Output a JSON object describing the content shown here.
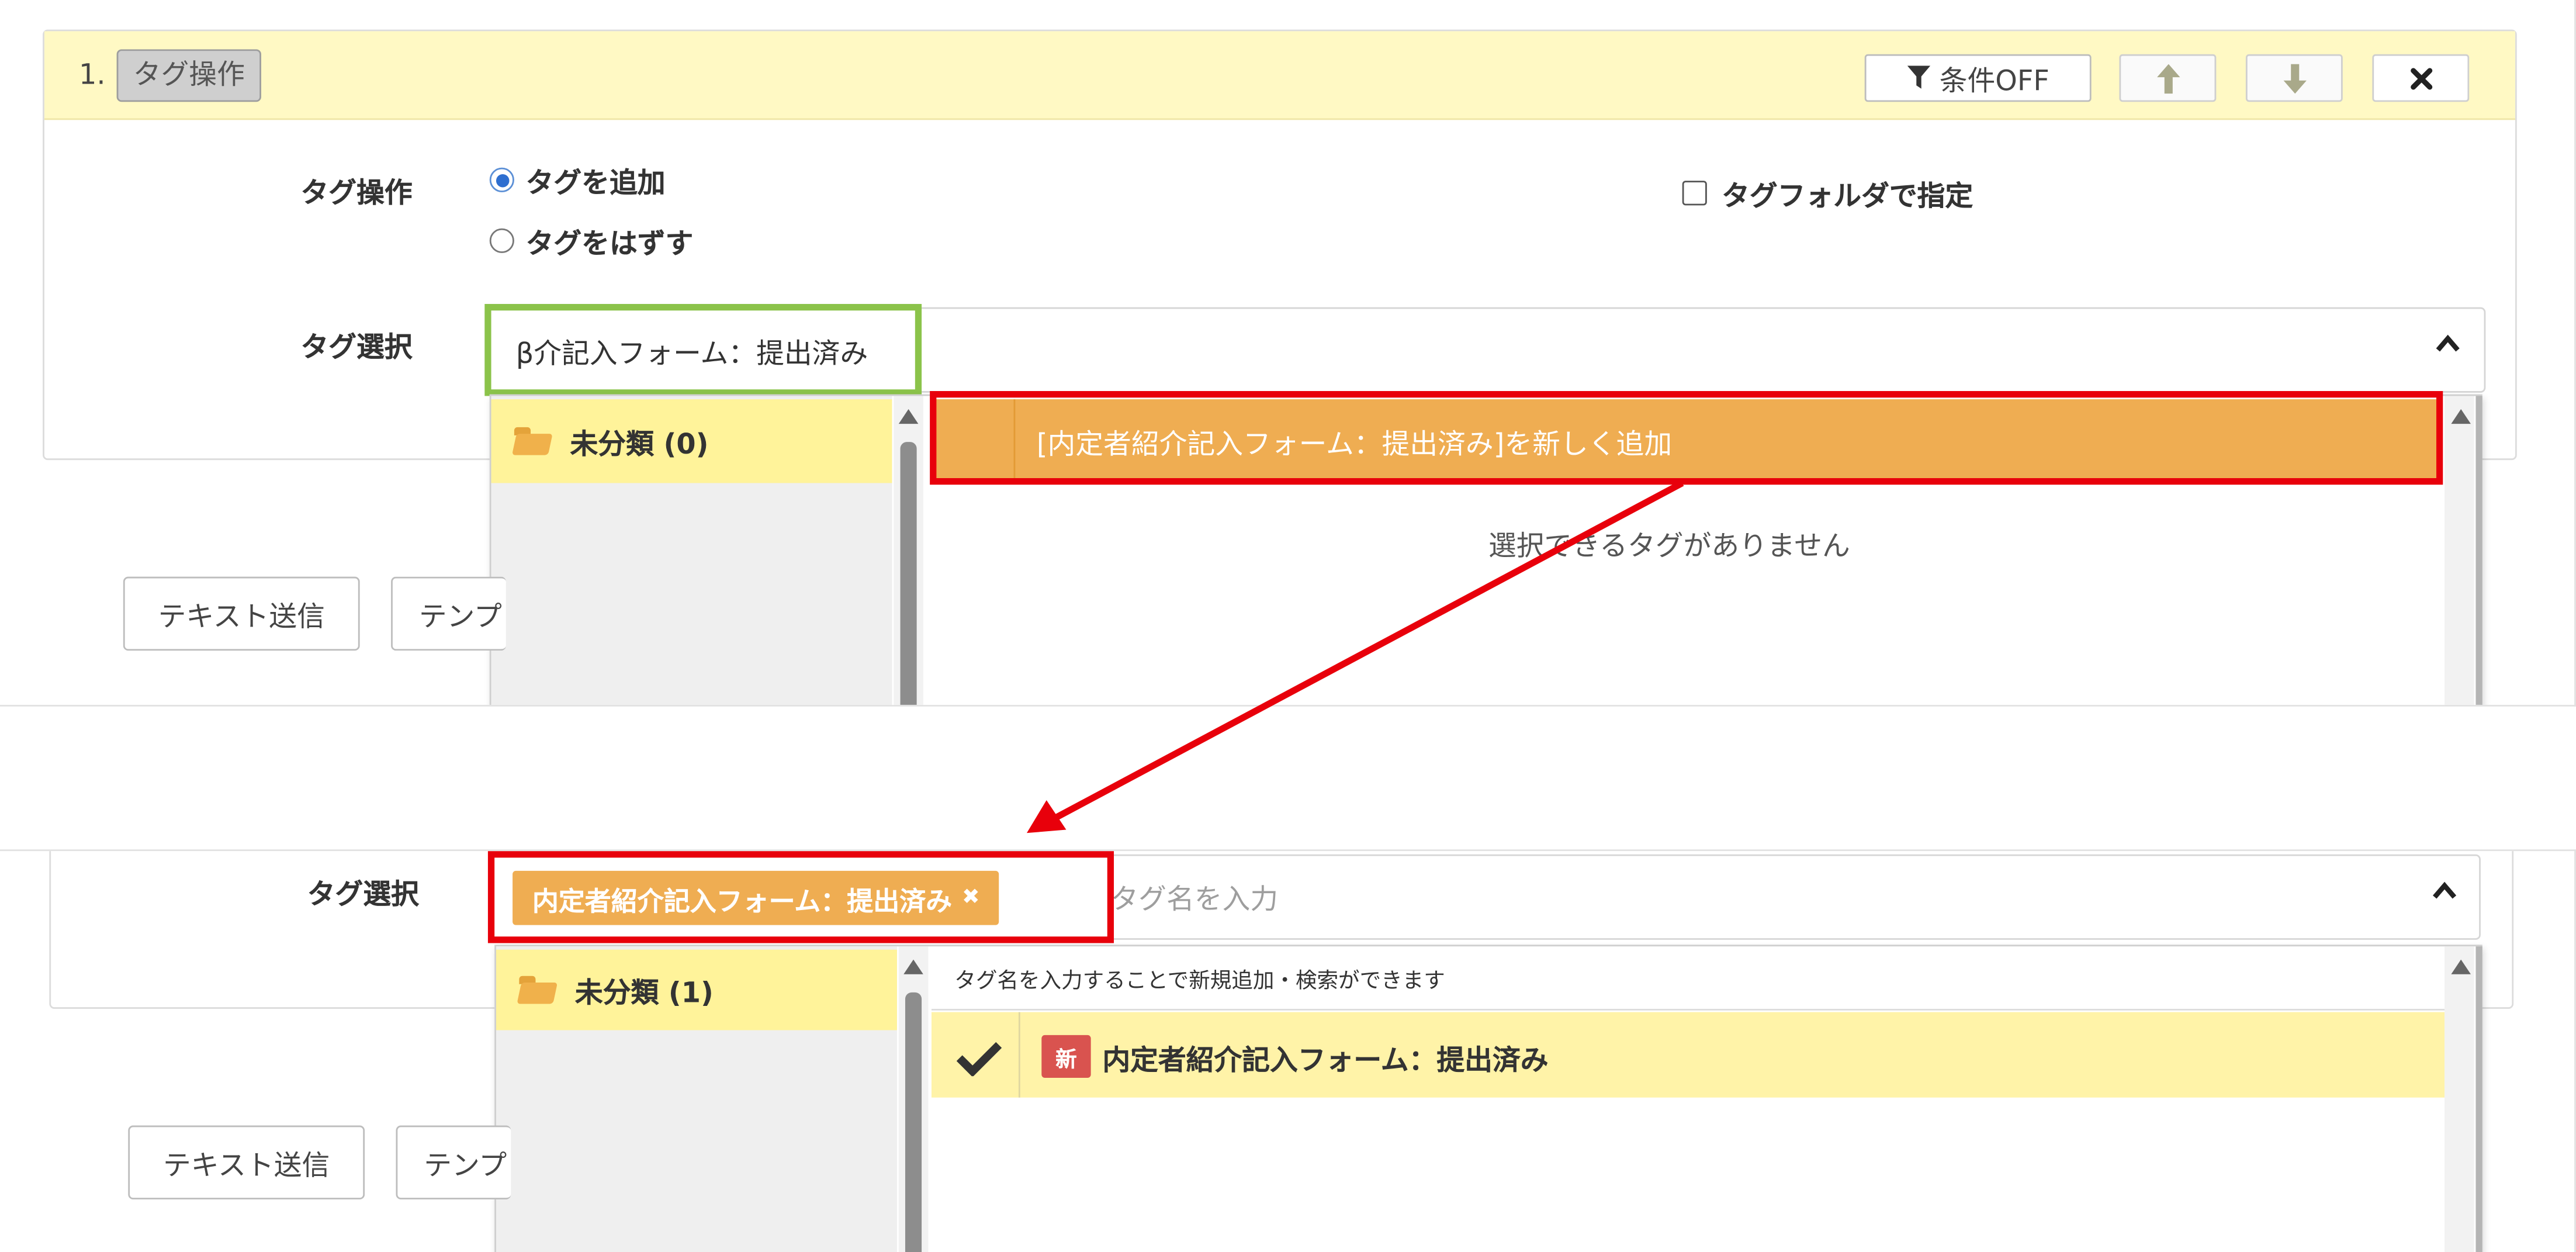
{
  "top": {
    "step_number": "1.",
    "step_tag": "タグ操作",
    "header_buttons": {
      "condition": "条件OFF"
    },
    "tag_operation_label": "タグ操作",
    "radio_add": "タグを追加",
    "radio_remove": "タグをはずす",
    "tag_folder_checkbox": "タグフォルダで指定",
    "tag_select_label": "タグ選択",
    "tag_search_value": "β介記入フォーム：提出済み",
    "folder_item": "未分類 (0)",
    "new_tag_option": "[内定者紹介記入フォーム：提出済み]を新しく追加",
    "no_tags_message": "選択できるタグがありません",
    "btn_text_send": "テキスト送信",
    "btn_template_partial": "テンプ"
  },
  "bottom": {
    "tag_select_label": "タグ選択",
    "selected_chip": "内定者紹介記入フォーム：提出済み",
    "chip_remove": "✖",
    "tag_input_placeholder": "タグ名を入力",
    "folder_item": "未分類 (1)",
    "hint_text": "タグ名を入力することで新規追加・検索ができます",
    "new_badge": "新",
    "tag_item": "内定者紹介記入フォーム：提出済み",
    "btn_text_send": "テキスト送信",
    "btn_template_partial": "テンプ"
  },
  "colors": {
    "header_bg": "#fff9c4",
    "highlight_orange": "#efad52",
    "folder_yellow": "#fff39a",
    "selected_row_yellow": "#fff3a8",
    "annotation_red": "#e8000b",
    "annotation_green": "#8bc34a",
    "new_badge_red": "#d9534f"
  },
  "icons": [
    "filter-icon",
    "arrow-up-icon",
    "arrow-down-icon",
    "close-icon",
    "chevron-up-icon",
    "folder-icon",
    "checkmark-icon"
  ]
}
